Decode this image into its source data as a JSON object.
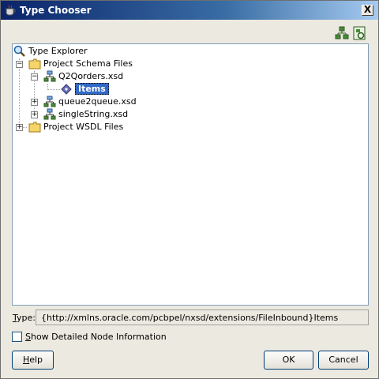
{
  "window": {
    "title": "Type Chooser",
    "close_label": "X"
  },
  "toolbar": {
    "icons": [
      "schema-add-icon",
      "schema-refresh-icon"
    ]
  },
  "tree": {
    "root": {
      "label": "Type Explorer",
      "icon": "search-icon"
    },
    "nodes": [
      {
        "label": "Project Schema Files",
        "icon": "folder-icon",
        "expanded": true
      },
      {
        "label": "Q2Qorders.xsd",
        "icon": "schema-icon",
        "expanded": true
      },
      {
        "label": "Items",
        "icon": "element-icon",
        "selected": true
      },
      {
        "label": "queue2queue.xsd",
        "icon": "schema-icon",
        "expanded": false
      },
      {
        "label": "singleString.xsd",
        "icon": "schema-icon",
        "expanded": false
      },
      {
        "label": "Project WSDL Files",
        "icon": "folder-icon",
        "expanded": false
      }
    ]
  },
  "type_field": {
    "label_prefix": "T",
    "label_rest": "ype:",
    "value": "{http://xmlns.oracle.com/pcbpel/nxsd/extensions/FileInbound}Items"
  },
  "detail_checkbox": {
    "checked": false,
    "label_prefix": "S",
    "label_rest": "how Detailed Node Information"
  },
  "buttons": {
    "help_prefix": "H",
    "help_rest": "elp",
    "ok": "OK",
    "cancel": "Cancel"
  }
}
